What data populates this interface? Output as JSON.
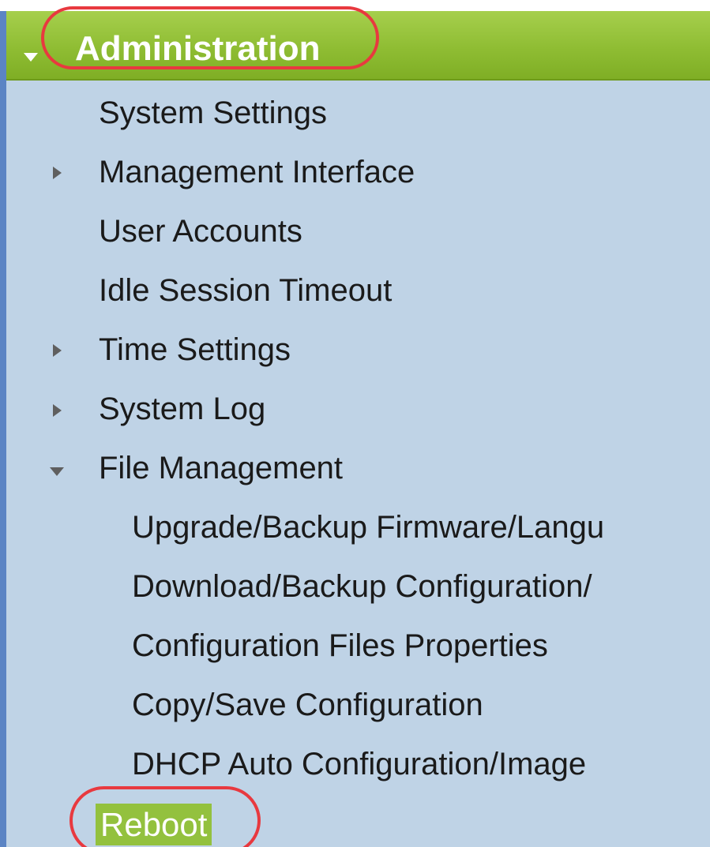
{
  "nav": {
    "section": {
      "title": "Administration",
      "expanded": true
    },
    "items": [
      {
        "label": "System Settings",
        "level": 1,
        "expander": "none"
      },
      {
        "label": "Management Interface",
        "level": 1,
        "expander": "collapsed"
      },
      {
        "label": "User Accounts",
        "level": 1,
        "expander": "none"
      },
      {
        "label": "Idle Session Timeout",
        "level": 1,
        "expander": "none"
      },
      {
        "label": "Time Settings",
        "level": 1,
        "expander": "collapsed"
      },
      {
        "label": "System Log",
        "level": 1,
        "expander": "collapsed"
      },
      {
        "label": "File Management",
        "level": 1,
        "expander": "expanded"
      },
      {
        "label": "Upgrade/Backup Firmware/Langu",
        "level": 2,
        "expander": "none"
      },
      {
        "label": "Download/Backup Configuration/",
        "level": 2,
        "expander": "none"
      },
      {
        "label": "Configuration Files Properties",
        "level": 2,
        "expander": "none"
      },
      {
        "label": "Copy/Save Configuration",
        "level": 2,
        "expander": "none"
      },
      {
        "label": "DHCP Auto Configuration/Image",
        "level": 2,
        "expander": "none"
      }
    ],
    "selected": {
      "label": "Reboot"
    }
  },
  "colors": {
    "panel_background": "#bfd3e6",
    "header_green": "#8fbd33",
    "selected_green": "#93c13e",
    "highlight_red": "#e8393f",
    "left_border_blue": "#5b84c4"
  }
}
